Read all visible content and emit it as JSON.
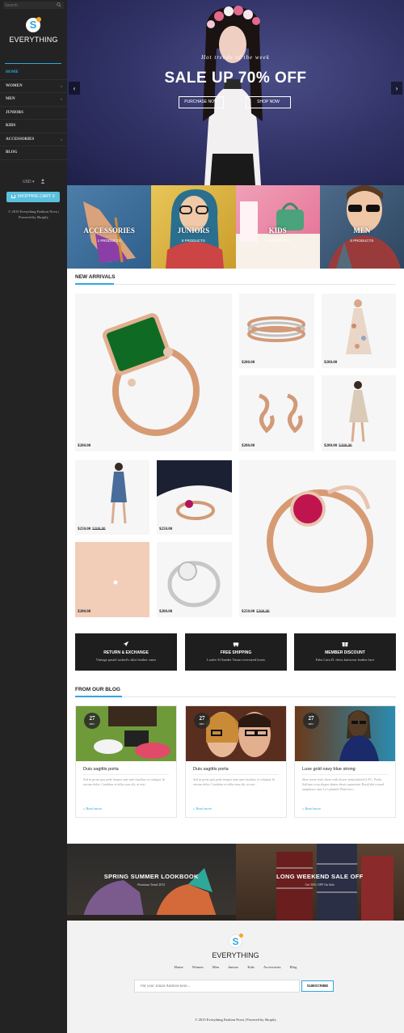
{
  "sidebar": {
    "search_placeholder": "Search",
    "logo_letter": "S",
    "logo_text": "EVERYTHING",
    "nav": [
      {
        "label": "Home",
        "has_sub": false,
        "active": true
      },
      {
        "label": "Women",
        "has_sub": true
      },
      {
        "label": "Men",
        "has_sub": true
      },
      {
        "label": "Juniors",
        "has_sub": false
      },
      {
        "label": "Kids",
        "has_sub": false
      },
      {
        "label": "Accessories",
        "has_sub": true
      },
      {
        "label": "Blog",
        "has_sub": false
      }
    ],
    "currency": "USD ▾",
    "cart_label": "SHOPPING CART: 0",
    "copyright_line1": "© 2015 Everything Fashion Nova |",
    "copyright_line2": "Powered by Shopify"
  },
  "hero": {
    "tagline": "Hot trends of the week",
    "title": "SALE UP 70% OFF",
    "btn_purchase": "PURCHASE NOW",
    "btn_shop": "SHOP NOW",
    "prev": "‹",
    "next": "›"
  },
  "categories": [
    {
      "title": "Accessories",
      "count": "1 products"
    },
    {
      "title": "Juniors",
      "count": "8 products"
    },
    {
      "title": "Kids",
      "count": "8 products"
    },
    {
      "title": "Men",
      "count": "8 products"
    }
  ],
  "new_arrivals": {
    "title": "New Arrivals",
    "products": [
      {
        "price": "$200.00",
        "old": ""
      },
      {
        "price": "$200.00",
        "old": ""
      },
      {
        "price": "$200.00",
        "old": ""
      },
      {
        "price": "$200.00",
        "old": ""
      },
      {
        "price": "$200.00",
        "old": "$300.00"
      },
      {
        "price": "$250.00",
        "old": "$300.00"
      },
      {
        "price": "$250.00",
        "old": ""
      },
      {
        "price": "$200.00",
        "old": ""
      },
      {
        "price": "$200.00",
        "old": ""
      },
      {
        "price": "$250.00",
        "old": "$300.00"
      }
    ]
  },
  "services": [
    {
      "title": "Return & Exchange",
      "desc": "Vintage pastel tocked's shirt leather cases",
      "icon": "rocket-icon"
    },
    {
      "title": "Free Shipping",
      "desc": "Loafer Sl Sander Vasari oversized boots",
      "icon": "truck-icon"
    },
    {
      "title": "Member Discount",
      "desc": "Fabs Cara D. dress knitwear leather lace",
      "icon": "gift-icon"
    }
  ],
  "blog": {
    "title": "From Our Blog",
    "posts": [
      {
        "day": "27",
        "month": "DEC",
        "title": "Duis sagittis porta",
        "excerpt": "Sed in proin quis pede tempor ante ante faucibus et volutpat. In rutrum dolor. Curabitur et tellus non elit, at erat...",
        "more": "» Read more"
      },
      {
        "day": "27",
        "month": "DEC",
        "title": "Duis sagittis porta",
        "excerpt": "Sed in proin quis pede tempor ante ante faucibus et volutpat. In rutrum dolor. Curabitur et tellus non elit, at erat...",
        "more": "» Read more"
      },
      {
        "day": "27",
        "month": "DEC",
        "title": "Luxe gold navy blue strong",
        "excerpt": "Shoe street style shoes with flower embroidered A.P.C. Prada Saffiano crop slipper denim shorts spearmint. Braid skirt round sunglasses sans Lo's pleated. Plain lace...",
        "more": "» Read more"
      }
    ]
  },
  "lookbook": [
    {
      "title": "Spring Summer Lookbook",
      "sub": "Premium Trend 2015"
    },
    {
      "title": "Long Weekend Sale Off",
      "sub": "Get 30% OFF On Sale"
    }
  ],
  "footer": {
    "logo_letter": "S",
    "brand": "EVERYTHING",
    "nav": [
      "Home",
      "Women",
      "Men",
      "Juniors",
      "Kids",
      "Accessories",
      "Blog"
    ],
    "newsletter_placeholder": "Put your Email Address here...",
    "subscribe": "SUBSCRIBE",
    "copyright": "© 2015 Everything Fashion Nova | Powered by Shopify"
  },
  "colors": {
    "accent": "#2fa7e0",
    "sidebar": "#232323",
    "service_bg": "#1e1e1e"
  }
}
